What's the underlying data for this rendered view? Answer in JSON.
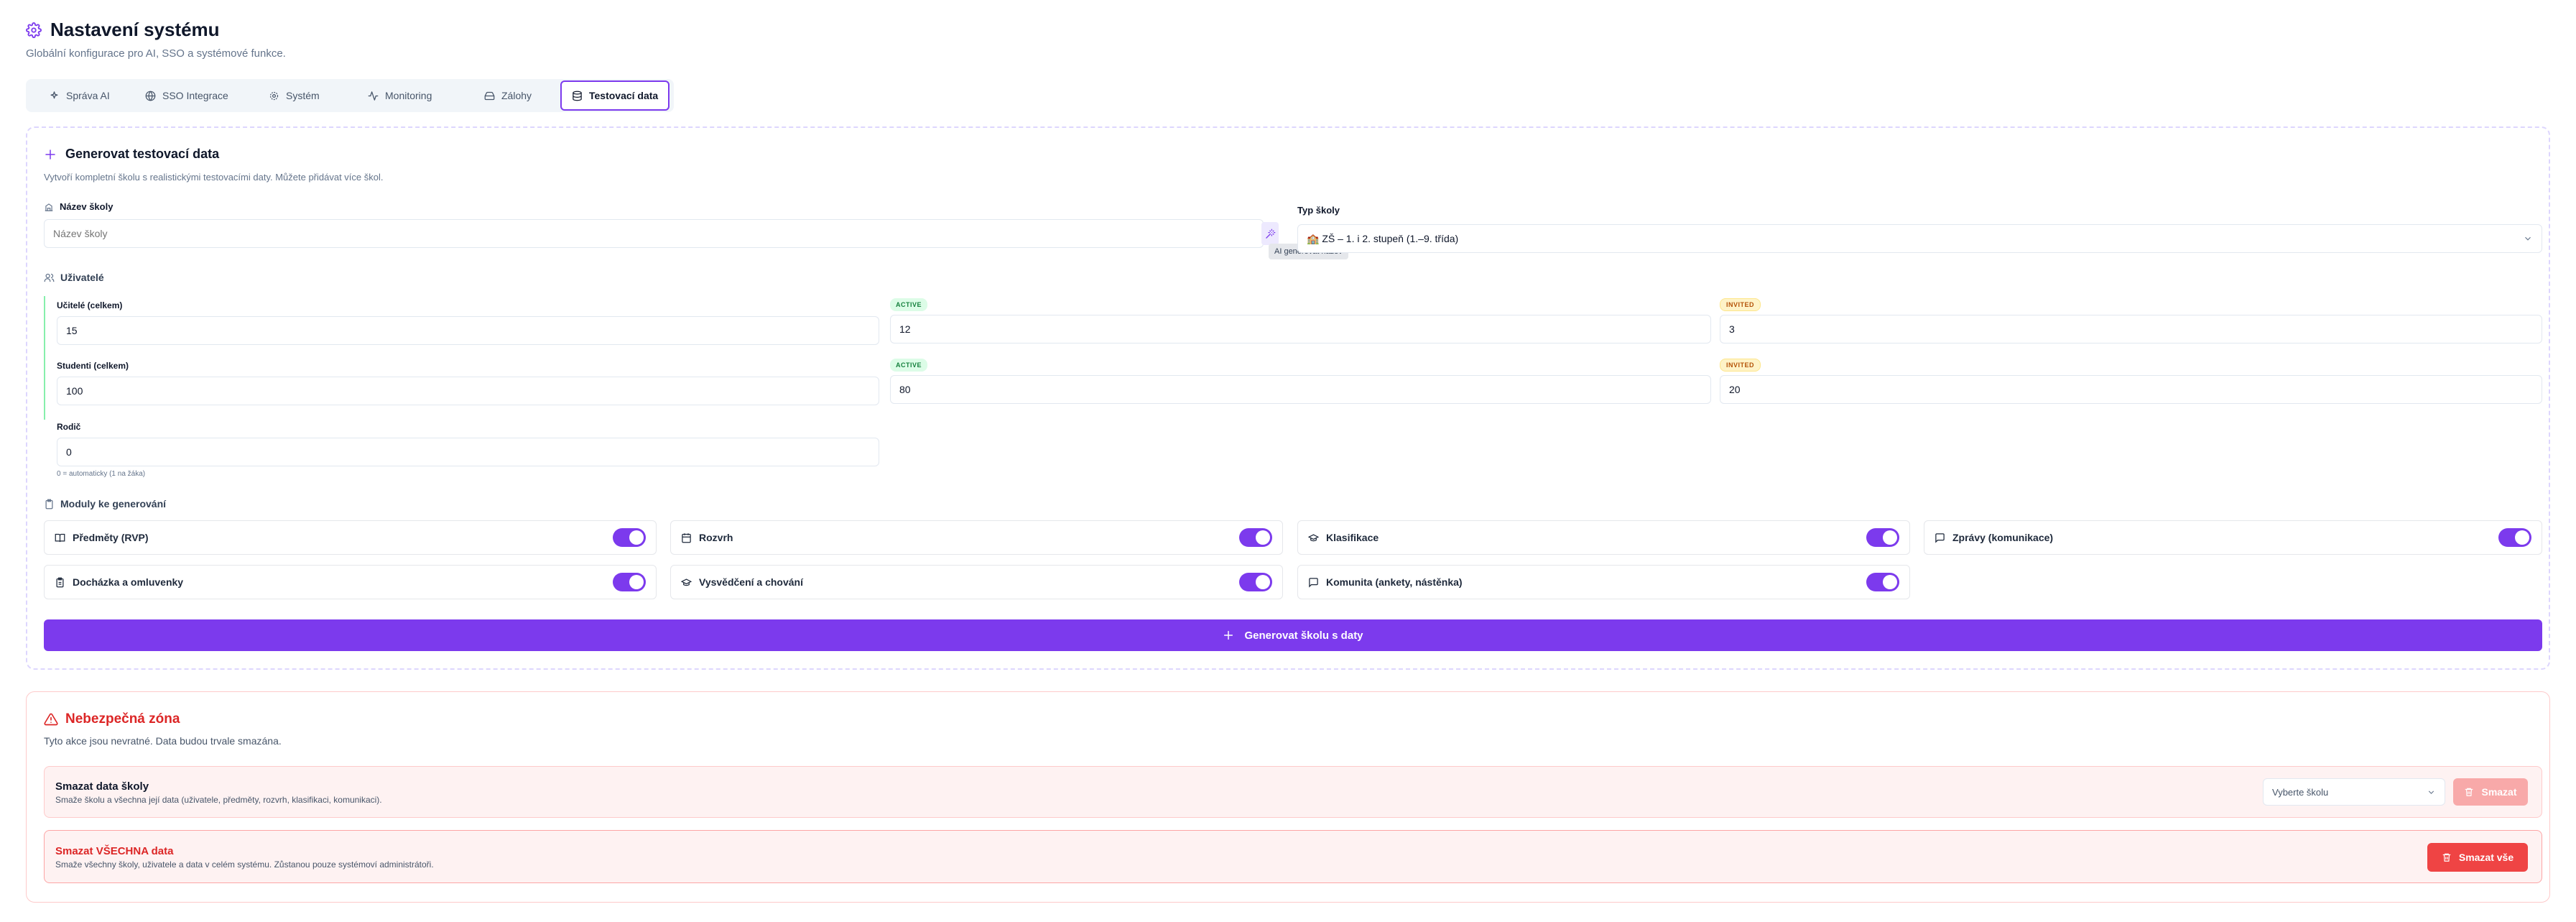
{
  "header": {
    "title": "Nastavení systému",
    "subtitle": "Globální konfigurace pro AI, SSO a systémové funkce."
  },
  "tabs": [
    {
      "label": "Správa AI",
      "icon": "sparkles-icon",
      "active": false
    },
    {
      "label": "SSO Integrace",
      "icon": "globe-icon",
      "active": false
    },
    {
      "label": "Systém",
      "icon": "gear-icon",
      "active": false
    },
    {
      "label": "Monitoring",
      "icon": "activity-icon",
      "active": false
    },
    {
      "label": "Zálohy",
      "icon": "drive-icon",
      "active": false
    },
    {
      "label": "Testovací data",
      "icon": "database-icon",
      "active": true
    }
  ],
  "generator": {
    "title": "Generovat testovací data",
    "description": "Vytvoří kompletní školu s realistickými testovacími daty. Můžete přidávat více škol.",
    "school_name": {
      "label": "Název školy",
      "placeholder": "Název školy",
      "ai_tooltip": "AI generovat název"
    },
    "school_type": {
      "label": "Typ školy",
      "value": "🏫 ZŠ – 1. i 2. stupeň (1.–9. třída)"
    },
    "users": {
      "title": "Uživatelé",
      "teachers": {
        "label": "Učitelé (celkem)",
        "total": "15",
        "active_badge": "ACTIVE",
        "active": "12",
        "invited_badge": "INVITED",
        "invited": "3"
      },
      "students": {
        "label": "Studenti (celkem)",
        "total": "100",
        "active_badge": "ACTIVE",
        "active": "80",
        "invited_badge": "INVITED",
        "invited": "20"
      },
      "parents": {
        "label": "Rodič",
        "value": "0",
        "hint": "0 = automaticky (1 na žáka)"
      }
    },
    "modules": {
      "title": "Moduly ke generování",
      "items": [
        {
          "label": "Předměty (RVP)",
          "icon": "book-icon",
          "enabled": true
        },
        {
          "label": "Rozvrh",
          "icon": "calendar-icon",
          "enabled": true
        },
        {
          "label": "Klasifikace",
          "icon": "graduation-cap-icon",
          "enabled": true
        },
        {
          "label": "Zprávy (komunikace)",
          "icon": "message-icon",
          "enabled": true
        },
        {
          "label": "Docházka a omluvenky",
          "icon": "clipboard-icon",
          "enabled": true
        },
        {
          "label": "Vysvědčení a chování",
          "icon": "graduation-cap-icon",
          "enabled": true
        },
        {
          "label": "Komunita (ankety, nástěnka)",
          "icon": "message-icon",
          "enabled": true
        }
      ]
    },
    "submit_label": "Generovat školu s daty"
  },
  "danger": {
    "title": "Nebezpečná zóna",
    "description": "Tyto akce jsou nevratné. Data budou trvale smazána.",
    "delete_school": {
      "title": "Smazat data školy",
      "description": "Smaže školu a všechna její data (uživatele, předměty, rozvrh, klasifikaci, komunikaci).",
      "select_placeholder": "Vyberte školu",
      "button": "Smazat"
    },
    "delete_all": {
      "title": "Smazat VŠECHNA data",
      "description": "Smaže všechny školy, uživatele a data v celém systému. Zůstanou pouze systémoví administrátoři.",
      "button": "Smazat vše"
    }
  },
  "colors": {
    "accent": "#7c3aed",
    "danger": "#dc2626",
    "danger_bg": "#fef2f2"
  }
}
